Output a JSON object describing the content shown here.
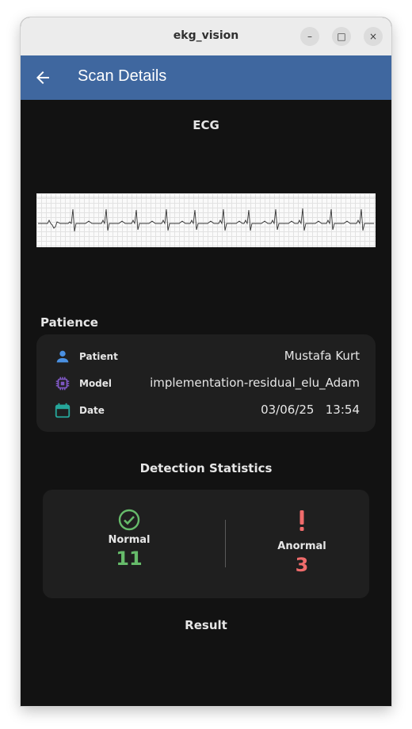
{
  "window": {
    "title": "ekg_vision"
  },
  "window_controls": {
    "minimize": "–",
    "maximize": "□",
    "close": "×"
  },
  "appbar": {
    "title": "Scan Details",
    "back_icon": "arrow-back-icon"
  },
  "ecg": {
    "title": "ECG"
  },
  "patience": {
    "title": "Patience",
    "rows": [
      {
        "label": "Patient",
        "value": "Mustafa Kurt",
        "icon": "person-icon",
        "color": "#4a90e2"
      },
      {
        "label": "Model",
        "value": "implementation-residual_elu_Adam",
        "icon": "chip-icon",
        "color": "#7e57c2"
      },
      {
        "label": "Date",
        "value": "03/06/25   13:54",
        "icon": "calendar-icon",
        "color": "#26a69a"
      }
    ]
  },
  "stats": {
    "title": "Detection Statistics",
    "normal": {
      "label": "Normal",
      "value": "11",
      "color": "#66bb6a"
    },
    "abnormal": {
      "label": "Anormal",
      "value": "3",
      "color": "#ef6b6b"
    }
  },
  "result": {
    "title": "Result"
  }
}
